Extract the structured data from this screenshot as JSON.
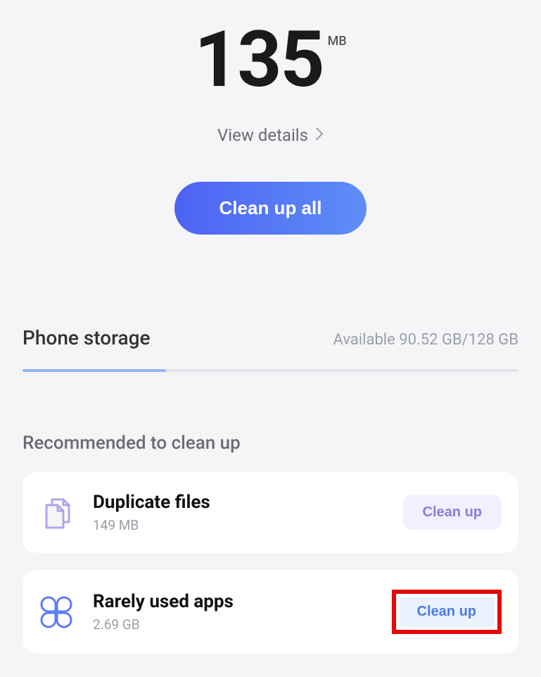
{
  "summary": {
    "amount": "135",
    "unit": "MB",
    "details_label": "View details",
    "cleanup_all_label": "Clean up all"
  },
  "storage": {
    "title": "Phone storage",
    "status": "Available 90.52 GB/128 GB",
    "used_percent": 29
  },
  "recommended": {
    "title": "Recommended to clean up",
    "items": [
      {
        "title": "Duplicate files",
        "size": "149 MB",
        "action": "Clean up",
        "highlighted": false
      },
      {
        "title": "Rarely used apps",
        "size": "2.69 GB",
        "action": "Clean up",
        "highlighted": true
      }
    ]
  }
}
